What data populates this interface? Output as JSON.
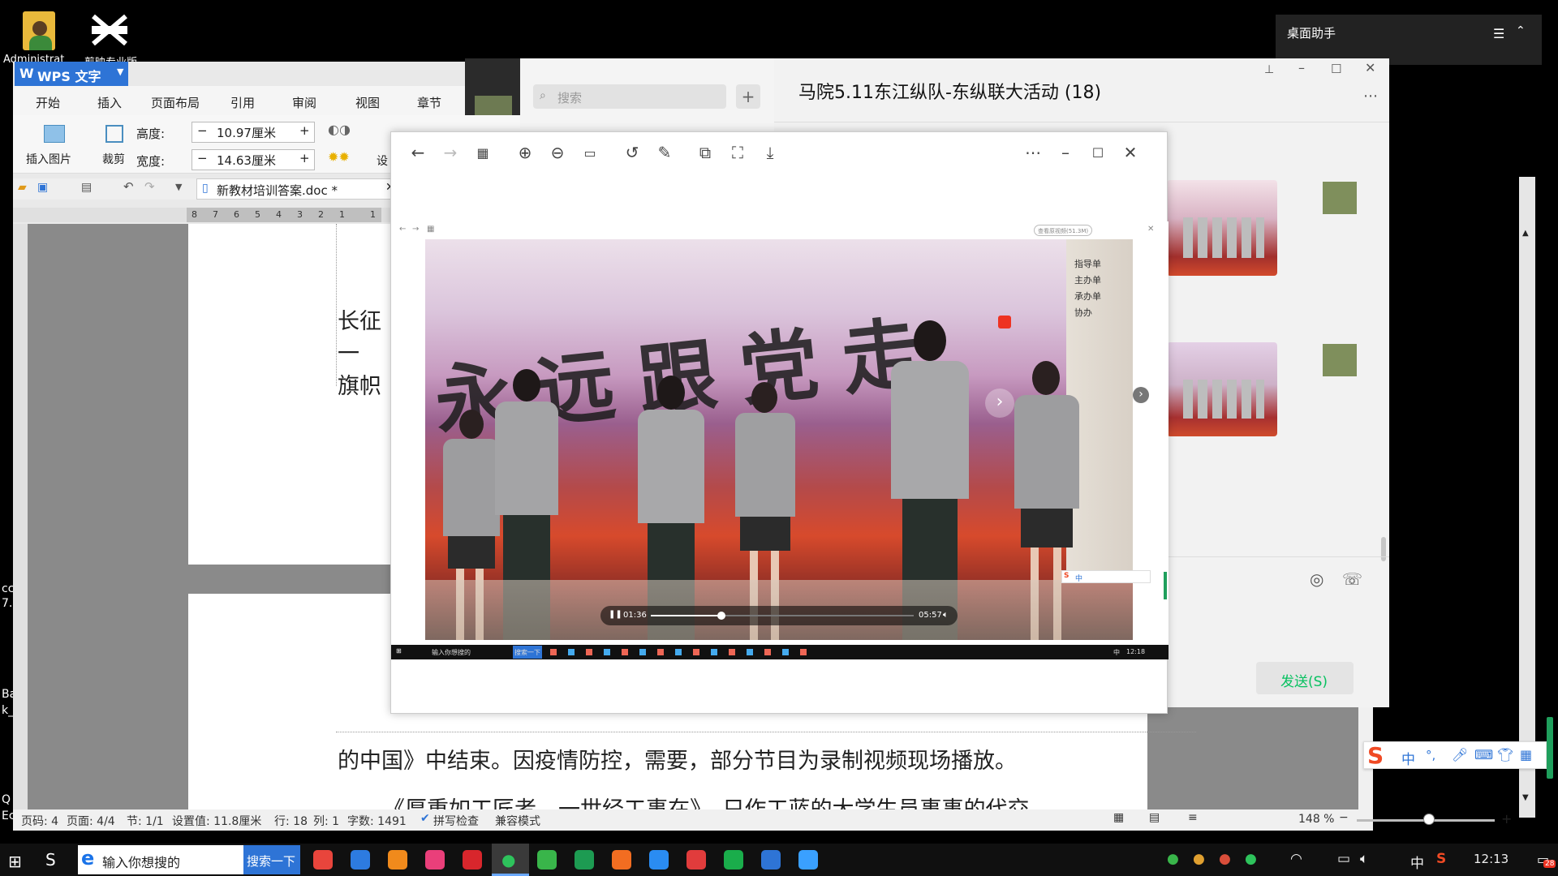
{
  "desktop": {
    "icon1_label": "Administrat",
    "icon2_label": "剪映专业版",
    "left_partial": [
      "cc",
      "7.",
      "Ba",
      "k_",
      "Q",
      "Ec"
    ]
  },
  "desktop_helper": {
    "title": "桌面助手"
  },
  "wps": {
    "app_name": "WPS 文字",
    "menu": [
      "开始",
      "插入",
      "页面布局",
      "引用",
      "审阅",
      "视图",
      "章节"
    ],
    "insert_picture": "插入图片",
    "crop": "裁剪",
    "height_label": "高度:",
    "height_value": "10.97厘米",
    "width_label": "宽度:",
    "width_value": "14.63厘米",
    "set_label": "设",
    "doc_tab": "新教材培训答案.doc *",
    "ruler_numbers": [
      "8",
      "7",
      "6",
      "5",
      "4",
      "3",
      "2",
      "1",
      "",
      "1"
    ],
    "doc_text": {
      "line1": "长征",
      "line2": "一",
      "line3": "旗帜",
      "bottom_line": "的中国》中结束。因疫情防控，需要，部分节目为录制视频现场播放。",
      "bottom_line2": "《厚重如工匠者，一世经工事在》，只作工蓝的大学生员事事的代交"
    },
    "status": {
      "page_code": "页码: 4",
      "pages": "页面: 4/4",
      "section": "节: 1/1",
      "setting": "设置值: 11.8厘米",
      "row": "行: 18",
      "col": "列: 1",
      "words": "字数: 1491",
      "spell": "拼写检查",
      "compat": "兼容模式",
      "zoom": "148 %"
    }
  },
  "wechat": {
    "search_placeholder": "搜索",
    "chat_title": "马院5.11东江纵队-东纵联大活动 (18)",
    "send_button": "发送(S)"
  },
  "viewer": {
    "inner_badge": "查看原视频(51.3M)",
    "time_current": "01:36",
    "time_total": "05:57",
    "video_progress": 0.27,
    "backdrop_text": "永远跟党走",
    "side_text": [
      "指导单",
      "主办单",
      "承办单",
      "协办"
    ],
    "inner_taskbar_search": "输入你想搜的",
    "inner_taskbar_button": "搜索一下",
    "inner_clock": "12:18",
    "inner_ime": "中"
  },
  "ime_bar": {
    "lang": "中",
    "punct": "°,"
  },
  "taskbar": {
    "search_text": "输入你想搜的",
    "search_button": "搜索一下",
    "ime": "中",
    "clock": "12:13",
    "badge": "28"
  }
}
